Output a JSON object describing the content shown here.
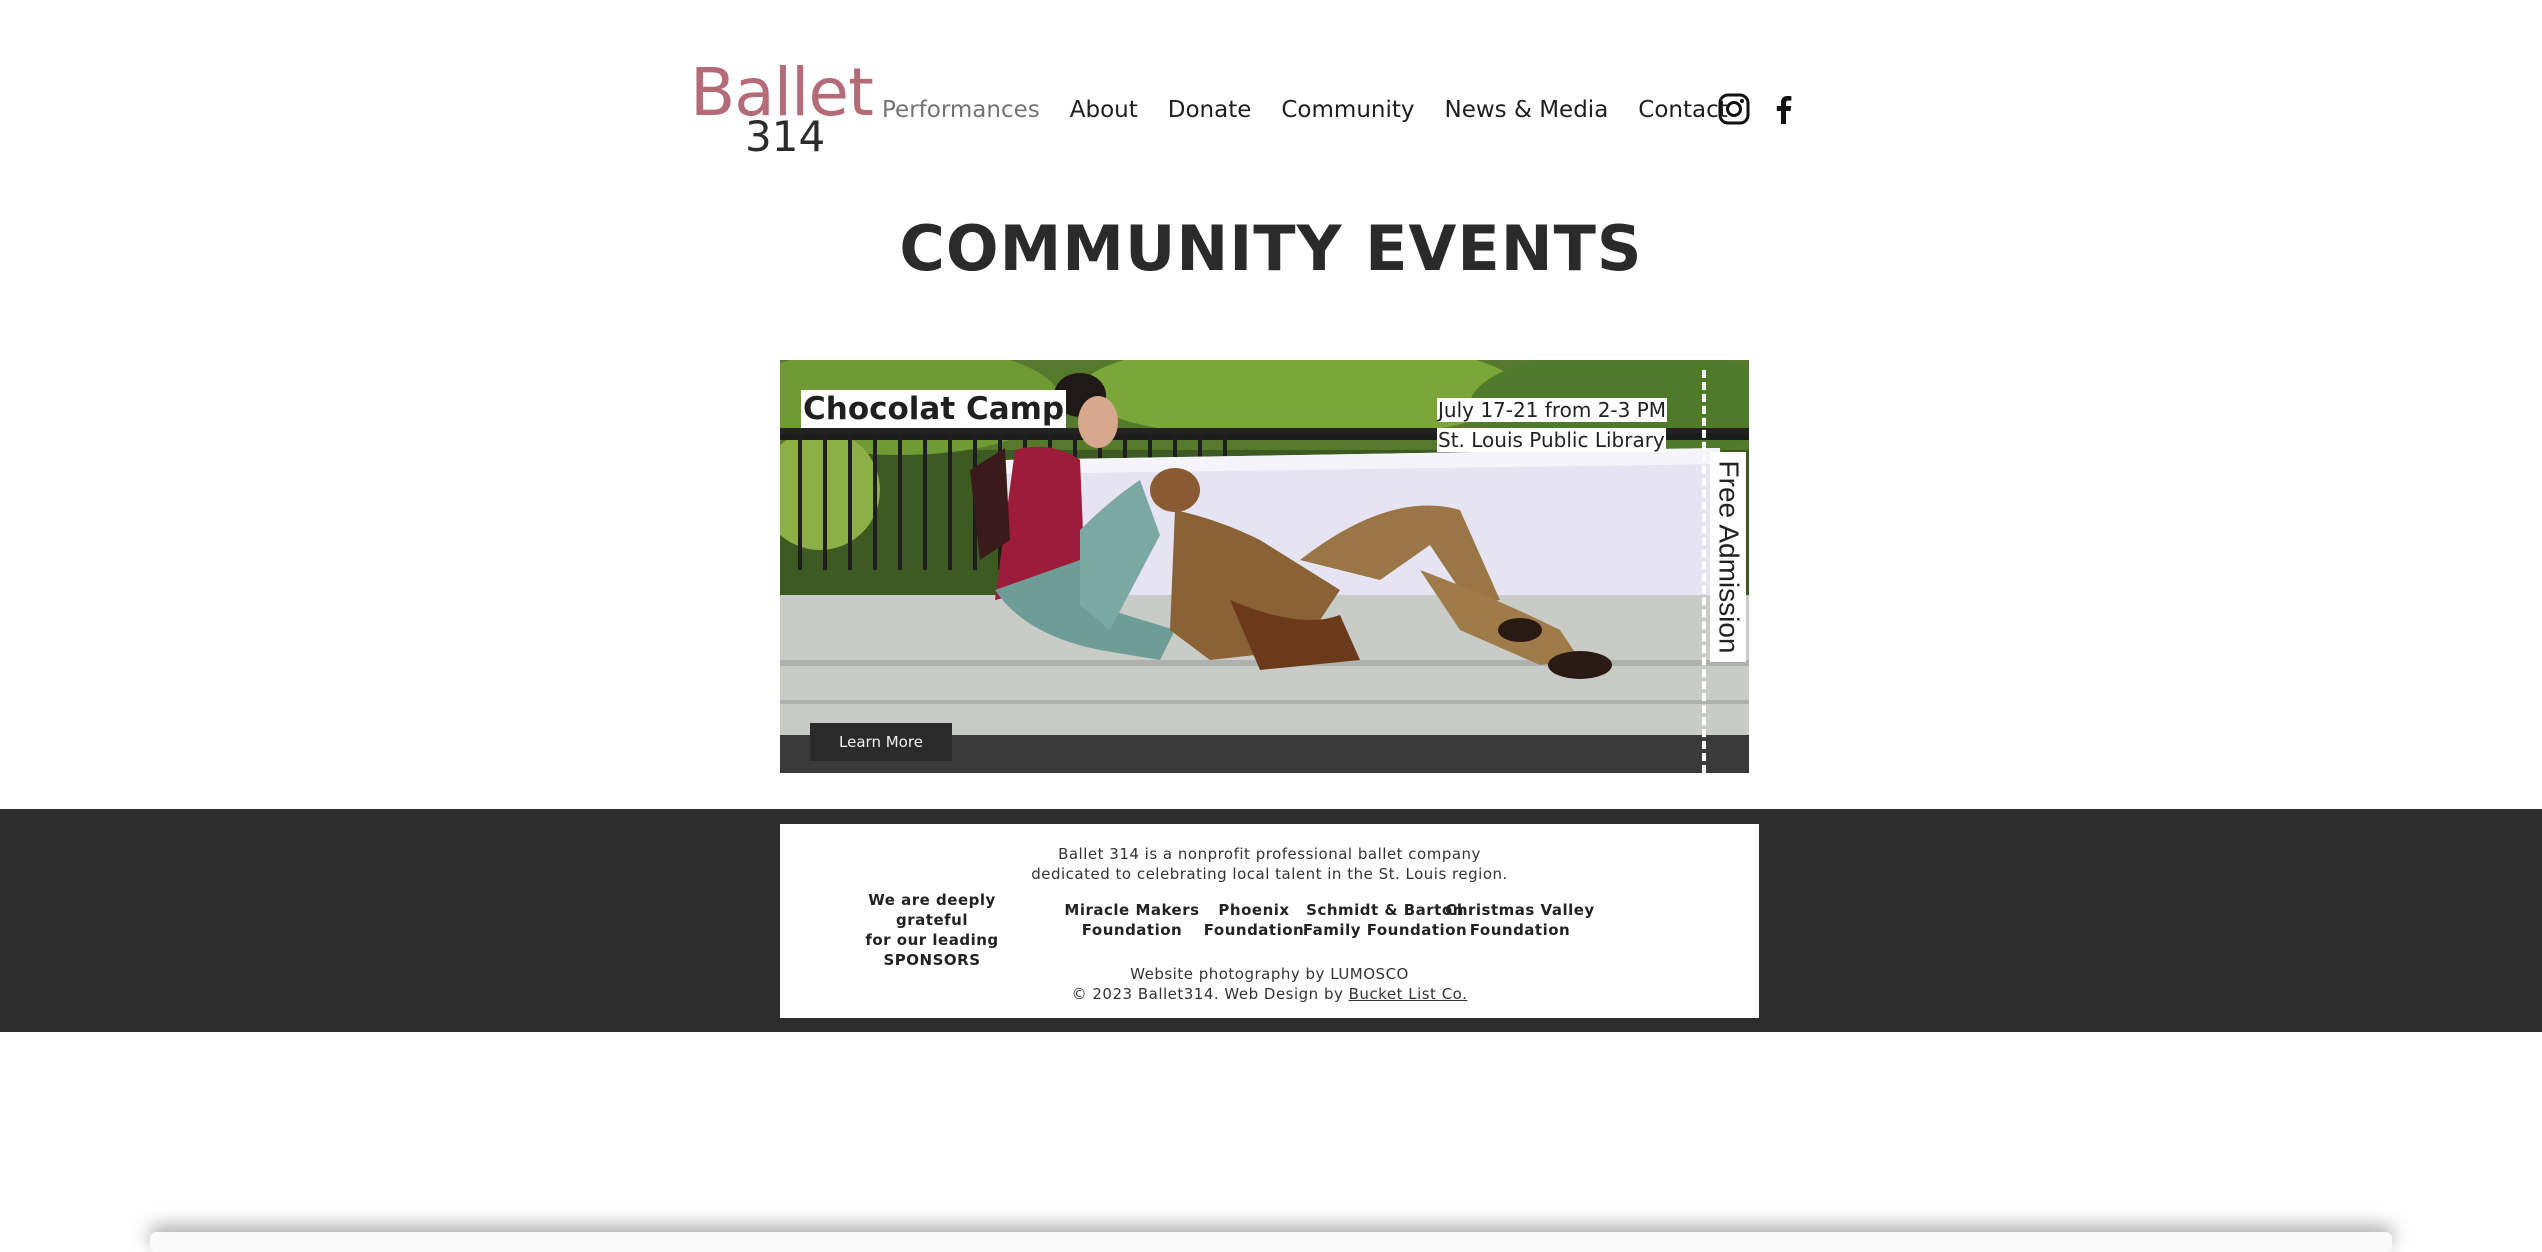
{
  "header": {
    "logo_top": "Ballet",
    "logo_bottom": "314",
    "nav": [
      "Performances",
      "About",
      "Donate",
      "Community",
      "News & Media",
      "Contact"
    ],
    "active_nav": "Performances",
    "social": [
      "instagram-icon",
      "facebook-icon"
    ]
  },
  "page": {
    "title": "COMMUNITY EVENTS"
  },
  "event": {
    "title": "Chocolat Camp",
    "date": "July 17-21 from 2-3 PM",
    "venue": "St. Louis Public Library",
    "admission": "Free Admission",
    "button": "Learn More"
  },
  "footer": {
    "description_line1": "Ballet 314 is a nonprofit professional ballet company",
    "description_line2": "dedicated to celebrating local talent in the St. Louis region.",
    "thanks_line1": "We are deeply grateful",
    "thanks_line2": "for our leading",
    "thanks_line3": "SPONSORS",
    "sponsors": [
      {
        "line1": "Miracle Makers",
        "line2": "Foundation"
      },
      {
        "line1": "Phoenix",
        "line2": "Foundation"
      },
      {
        "line1": "Schmidt & Barton",
        "line2": "Family Foundation"
      },
      {
        "line1": "Christmas Valley",
        "line2": "Foundation"
      }
    ],
    "photo_credit": "Website photography by LUMOSCO",
    "copyright": "© 2023 Ballet314. Web Design by",
    "designer_link": "Bucket List Co."
  },
  "colors": {
    "logo_accent": "#b56a78",
    "footer_band": "#2d2d2d",
    "button_bg": "#2a2a2a"
  }
}
